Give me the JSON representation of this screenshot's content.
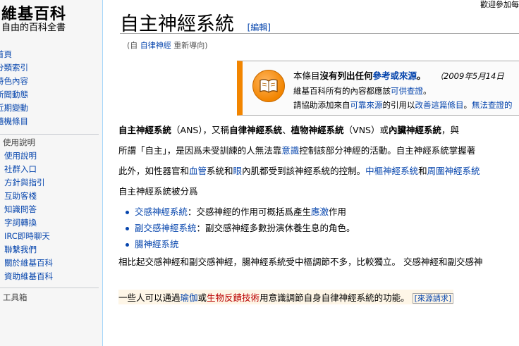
{
  "sidebar": {
    "logo_title": "維基百科",
    "logo_subtitle": "自由的百科全書",
    "nav": [
      "首頁",
      "分類索引",
      "特色內容",
      "新聞動態",
      "近期變動",
      "隨機條目"
    ],
    "portal_heading": "使用說明",
    "help": [
      "使用說明",
      "社群入口",
      "方針與指引",
      "互助客棧",
      "知識問答",
      "字詞轉換",
      "IRC即時聊天",
      "聯繫我們",
      "關於維基百科",
      "資助維基百科"
    ],
    "toolbox": "工具箱"
  },
  "header": {
    "welcome": "歡迎參加每"
  },
  "article": {
    "title": "自主神經系統",
    "edit": "[編輯]",
    "redirect_prefix": "(自",
    "redirect_link": "自律神經",
    "redirect_suffix": "重新導向)"
  },
  "ambox": {
    "l1_a": "本條目",
    "l1_b": "沒有列出任何",
    "l1_c": "參考或來源",
    "l1_d": "。",
    "l1_date": "（2009年5月14日",
    "l2_a": "維基百科所有的內容都應該",
    "l2_b": "可供查證",
    "l2_c": "。",
    "l3_a": "請協助添加來自",
    "l3_b": "可靠來源",
    "l3_c": "的引用以",
    "l3_d": "改善這篇條目",
    "l3_e": "。",
    "l3_f": "無法查證的"
  },
  "body": {
    "p1_a": "自主神經系統",
    "p1_b": "（ANS），又稱",
    "p1_c": "自律神經系統",
    "p1_d": "、",
    "p1_e": "植物神經系統",
    "p1_f": "（VNS）或",
    "p1_g": "內臟神經系統",
    "p1_h": "，與",
    "p2_a": "所謂「自主」，是因爲未受訓練的人無法靠",
    "p2_b": "意識",
    "p2_c": "控制該部分神經的活動。自主神經系統掌握著",
    "p3_a": "此外，如性器官和",
    "p3_b": "血管",
    "p3_c": "系統和",
    "p3_d": "眼",
    "p3_e": "內肌都受到該神經系統的控制。",
    "p3_f": "中樞神經系統",
    "p3_g": "和",
    "p3_h": "周圍神經系統",
    "p4": "自主神經系統被分爲",
    "b1_link": "交感神經系統",
    "b1_text": "：交感神經的作用可概括爲產生",
    "b1_link2": "應激",
    "b1_text2": "作用",
    "b2_link": "副交感神經系統",
    "b2_text": "：副交感神經多數扮演休養生息的角色。",
    "b3_link": "腸神經系統",
    "p5": "相比起交感神經和副交感神經，腸神經系統受中樞調節不多，比較獨立。 交感神經和副交感神",
    "p6_a": "一些人可以通過",
    "p6_b": "瑜伽",
    "p6_c": "或",
    "p6_d": "生物反饋技術",
    "p6_e": "用意識調節自身自律神經系統的功能。",
    "citation": "[來源請求]"
  }
}
